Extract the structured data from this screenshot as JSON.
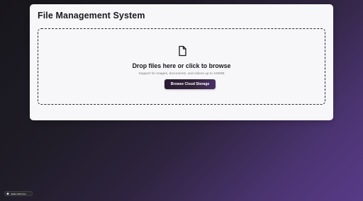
{
  "app": {
    "title": "File Management System"
  },
  "dropzone": {
    "icon": "file-icon",
    "heading": "Drop files here or click to browse",
    "support_text": "Support for images, documents, and videos up to 100MB",
    "button_label": "Browse Cloud Storage"
  },
  "badge": {
    "icon": "heart-icon",
    "label": "made with love"
  },
  "colors": {
    "button_gradient_start": "#2b1c34",
    "button_gradient_end": "#4b2f67",
    "background_accent": "#583a87"
  }
}
